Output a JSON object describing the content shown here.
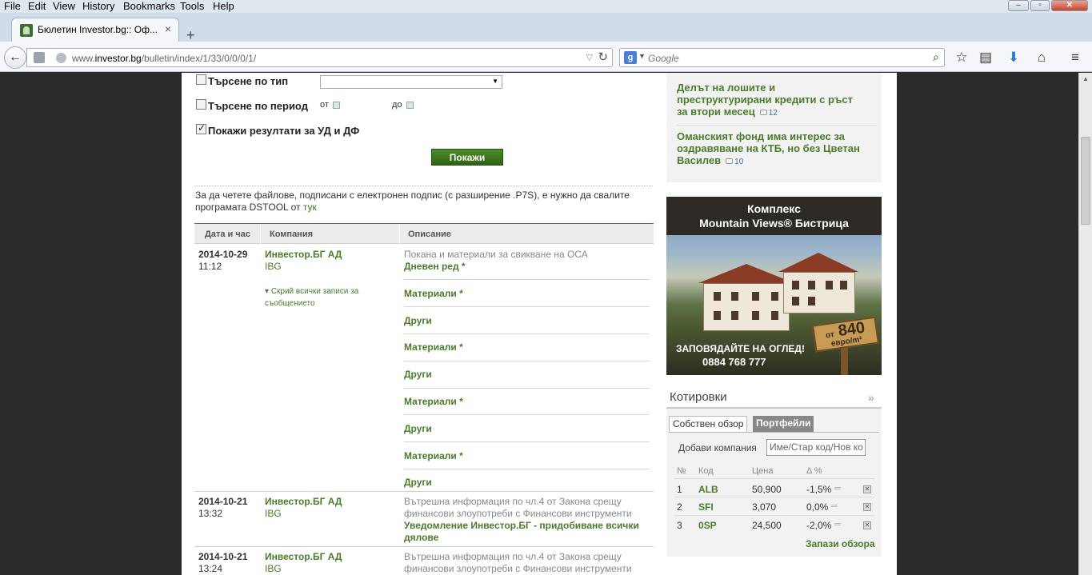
{
  "browser": {
    "menu": [
      "File",
      "Edit",
      "View",
      "History",
      "Bookmarks",
      "Tools",
      "Help"
    ],
    "tab_title": "Бюлетин Investor.bg:: Оф...",
    "url_prefix": "www.",
    "url_domain": "investor.bg",
    "url_path": "/bulletin/index/1/33/0/0/0/1/",
    "search_placeholder": "Google",
    "search_engine_glyph": "g",
    "icons": [
      "back-arrow-icon",
      "bookmarks-star-icon",
      "reading-list-icon",
      "download-icon",
      "home-icon",
      "menu-icon"
    ]
  },
  "filters": {
    "by_type_label": "Търсене по тип",
    "by_period_label": "Търсене по период",
    "from_label": "от",
    "to_label": "до",
    "show_funds_label": "Покажи резултати за УД и ДФ",
    "show_funds_checked": true,
    "show_button": "Покажи"
  },
  "notice": {
    "text": "За да четете файлове, подписани с електронен подпис (с разширение .P7S), е нужно да свалите програмата DSTOOL от ",
    "link": "тук"
  },
  "table": {
    "headers": [
      "Дата и час",
      "Компания",
      "Описание"
    ],
    "hide_all": "Скрий всички записи за съобщението",
    "rows": [
      {
        "date": "2014-10-29",
        "time": "11:12",
        "company": "Инвестор.БГ АД",
        "code": "IBG",
        "description": "Покана и материали за свикване на ОСА",
        "links": [
          "Дневен ред *",
          "Материали *",
          "Други",
          "Материали *",
          "Други",
          "Материали *",
          "Други",
          "Материали *",
          "Други"
        ]
      },
      {
        "date": "2014-10-21",
        "time": "13:32",
        "company": "Инвестор.БГ АД",
        "code": "IBG",
        "description_line1": "Вътрешна информация по чл.4 от Закона срещу",
        "description_line2": "финансови злоупотреби с Финансови инструменти",
        "link_line1": "Уведомление Инвестор.БГ - придобиване всички",
        "link_line2": "дялове"
      },
      {
        "date": "2014-10-21",
        "time": "13:24",
        "company": "Инвестор.БГ АД",
        "code": "IBG",
        "description_line1": "Вътрешна информация по чл.4 от Закона срещу",
        "description_line2": "финансови злоупотреби с Финансови инструменти"
      }
    ]
  },
  "news": [
    {
      "line1": "Делът на лошите и",
      "line2": "преструктурирани кредити с ръст",
      "line3": "за втори месец",
      "comments": "12"
    },
    {
      "line1": "Оманският фонд има интерес за",
      "line2": "оздравяване на КТБ, но без Цветан",
      "line3": "Василев",
      "comments": "10"
    }
  ],
  "ad": {
    "title1": "Комплекс",
    "title2": "Mountain Views® Бистрица",
    "price_prefix": "от",
    "price": "840",
    "price_unit": "евро/m²",
    "cta": "ЗАПОВЯДАЙТЕ НА ОГЛЕД!",
    "phone": "0884 768 777"
  },
  "quotes": {
    "title": "Котировки",
    "more": "»",
    "tab_own": "Собствен обзор",
    "tab_portfolios": "Портфейли",
    "add_label": "Добави компания",
    "add_placeholder": "Име/Стар код/Нов ко",
    "headers": [
      "№",
      "Код",
      "Цена",
      "Δ %"
    ],
    "rows": [
      {
        "n": "1",
        "code": "ALB",
        "price": "50,900",
        "change": "-1,5%"
      },
      {
        "n": "2",
        "code": "SFI",
        "price": "3,070",
        "change": "0,0%"
      },
      {
        "n": "3",
        "code": "0SP",
        "price": "24,500",
        "change": "-2,0%"
      }
    ],
    "save": "Запази обзора"
  }
}
